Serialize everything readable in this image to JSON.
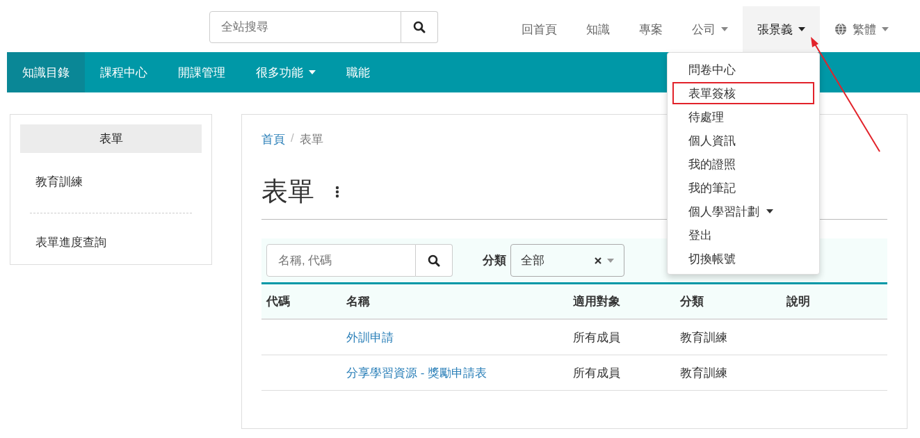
{
  "top_search": {
    "placeholder": "全站搜尋"
  },
  "top_nav": [
    {
      "label": "回首頁",
      "selected": false,
      "caret": false,
      "globe": false
    },
    {
      "label": "知識",
      "selected": false,
      "caret": false,
      "globe": false
    },
    {
      "label": "專案",
      "selected": false,
      "caret": false,
      "globe": false
    },
    {
      "label": "公司",
      "selected": false,
      "caret": true,
      "globe": false
    },
    {
      "label": "張景義",
      "selected": true,
      "caret": true,
      "globe": false,
      "menu": [
        {
          "label": "問卷中心",
          "highlighted": false,
          "kind": "link"
        },
        {
          "label": "表單簽核",
          "highlighted": true,
          "kind": "link"
        },
        {
          "label": "待處理",
          "highlighted": false,
          "kind": "link"
        },
        {
          "label": "個人資訊",
          "highlighted": false,
          "kind": "link"
        },
        {
          "label": "我的證照",
          "highlighted": false,
          "kind": "link"
        },
        {
          "label": "我的筆記",
          "highlighted": false,
          "kind": "link"
        },
        {
          "label": "個人學習計劃",
          "highlighted": false,
          "kind": "submenu"
        },
        {
          "label": "登出",
          "highlighted": false,
          "kind": "link"
        },
        {
          "label": "切換帳號",
          "highlighted": false,
          "kind": "link"
        }
      ]
    },
    {
      "label": "繁體",
      "selected": false,
      "caret": true,
      "globe": true
    }
  ],
  "main_nav": [
    {
      "label": "知識目錄",
      "selected": true,
      "caret": false
    },
    {
      "label": "課程中心",
      "selected": false,
      "caret": false
    },
    {
      "label": "開課管理",
      "selected": false,
      "caret": false
    },
    {
      "label": "很多功能",
      "selected": false,
      "caret": true
    },
    {
      "label": "職能",
      "selected": false,
      "caret": false
    }
  ],
  "sidebar": {
    "title": "表單",
    "items": [
      "教育訓練",
      "表單進度查詢"
    ]
  },
  "breadcrumb": {
    "items": [
      "首頁",
      "表單"
    ],
    "separator": "/"
  },
  "page_title": "表單",
  "filter": {
    "search_placeholder": "名稱, 代碼",
    "category_label": "分類",
    "category_value": "全部"
  },
  "table": {
    "columns": [
      "代碼",
      "名稱",
      "適用對象",
      "分類",
      "說明"
    ],
    "rows": [
      {
        "code": "",
        "name": "外訓申請",
        "audience": "所有成員",
        "category": "教育訓練"
      },
      {
        "code": "",
        "name": "分享學習資源 - 獎勵申請表",
        "audience": "所有成員",
        "category": "教育訓練"
      }
    ]
  }
}
